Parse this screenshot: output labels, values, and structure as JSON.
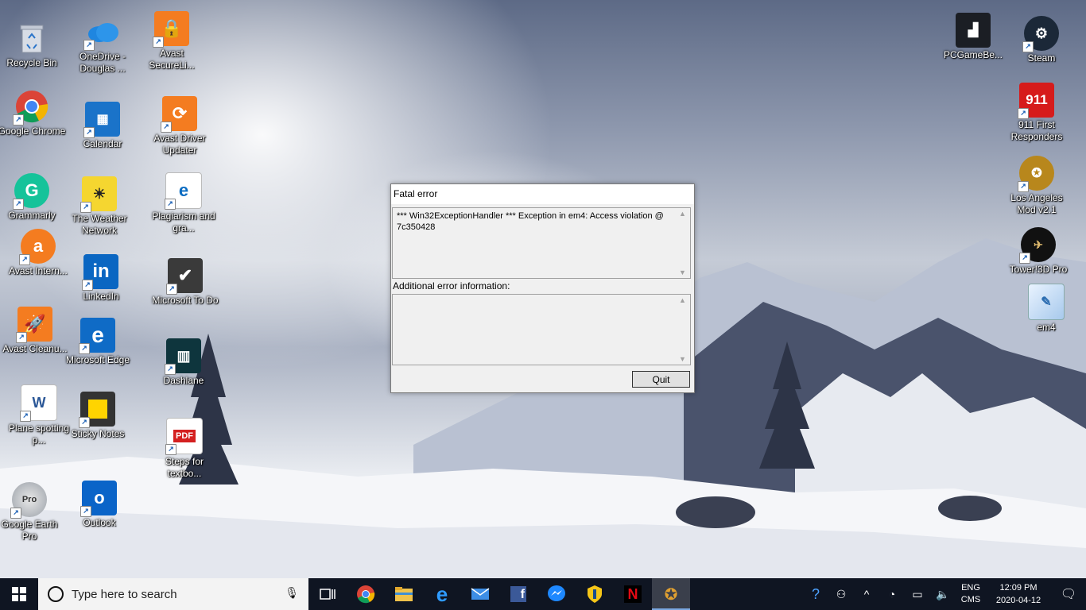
{
  "desktop": {
    "icons_left": [
      {
        "label": "Recycle Bin"
      },
      {
        "label": "OneDrive - Douglas ..."
      },
      {
        "label": "Avast SecureLi..."
      },
      {
        "label": "Google Chrome"
      },
      {
        "label": "Calendar"
      },
      {
        "label": "Avast Driver Updater"
      },
      {
        "label": "Grammarly"
      },
      {
        "label": "The Weather Network"
      },
      {
        "label": "Plagiarism and gra..."
      },
      {
        "label": "Avast Intern..."
      },
      {
        "label": "LinkedIn"
      },
      {
        "label": "Microsoft To Do"
      },
      {
        "label": "Avast Cleanu..."
      },
      {
        "label": "Microsoft Edge"
      },
      {
        "label": "Dashlane"
      },
      {
        "label": "Plane spotting p..."
      },
      {
        "label": "Sticky Notes"
      },
      {
        "label": "Steps for textbo..."
      },
      {
        "label": "Google Earth Pro"
      },
      {
        "label": "Outlook"
      }
    ],
    "icons_right": [
      {
        "label": "PCGameBe..."
      },
      {
        "label": "Steam"
      },
      {
        "label": "911 First Responders"
      },
      {
        "label": "Los Angeles Mod v2.1"
      },
      {
        "label": "Tower!3D Pro"
      },
      {
        "label": "em4"
      }
    ]
  },
  "dialog": {
    "title": "Fatal error",
    "error_text": "*** Win32ExceptionHandler *** Exception in em4: Access violation @ 7c350428",
    "additional_label": "Additional error information:",
    "additional_text": "",
    "quit_label": "Quit"
  },
  "taskbar": {
    "search_placeholder": "Type here to search",
    "apps": [
      "task-view",
      "chrome",
      "file-explorer",
      "edge",
      "mail",
      "facebook",
      "messenger",
      "unknown",
      "netflix",
      "em4"
    ],
    "lang_top": "ENG",
    "lang_bottom": "CMS",
    "time": "12:09 PM",
    "date": "2020-04-12"
  },
  "colors": {
    "taskbar": "#0f1522",
    "dialog_bg": "#f0f0f0",
    "accent": "#0078d7"
  }
}
